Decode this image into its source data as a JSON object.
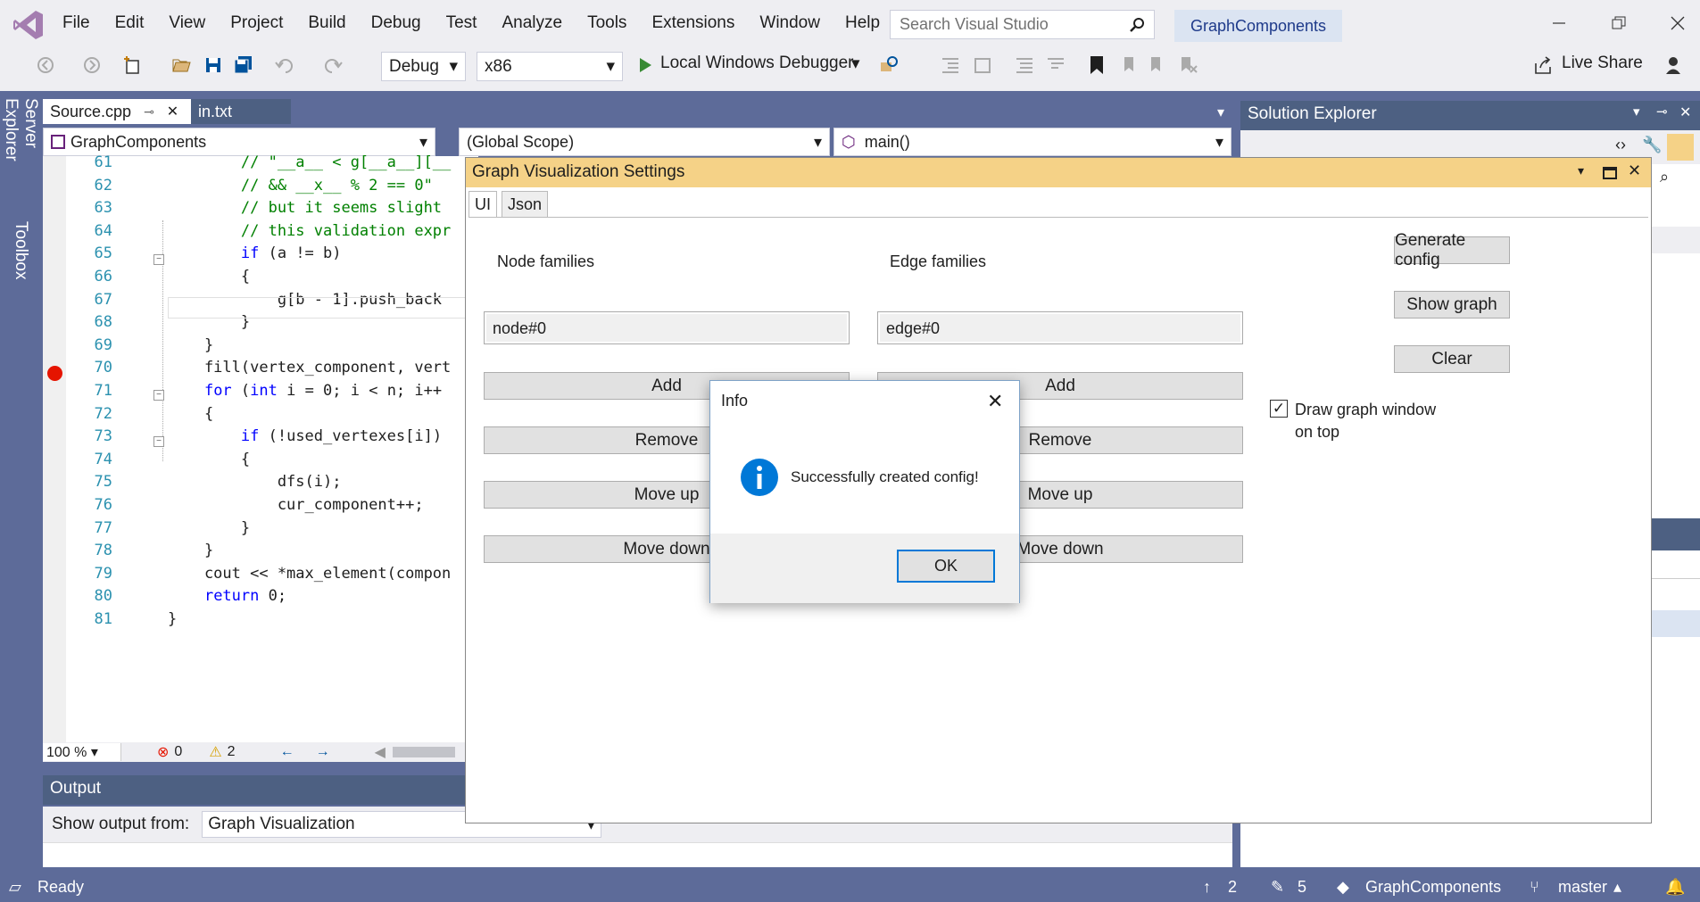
{
  "menu": [
    "File",
    "Edit",
    "View",
    "Project",
    "Build",
    "Debug",
    "Test",
    "Analyze",
    "Tools",
    "Extensions",
    "Window",
    "Help"
  ],
  "search": {
    "placeholder": "Search Visual Studio"
  },
  "solution_name": "GraphComponents",
  "toolbar": {
    "config": "Debug",
    "platform": "x86",
    "debugger": "Local Windows Debugger",
    "live_share": "Live Share"
  },
  "side_tabs": [
    "Server Explorer",
    "Toolbox"
  ],
  "doc_tabs": [
    {
      "label": "Source.cpp"
    },
    {
      "label": "in.txt"
    }
  ],
  "nav": {
    "project": "GraphComponents",
    "scope": "(Global Scope)",
    "member": "main()"
  },
  "code_lines": [
    {
      "n": "61",
      "text": "        // \"__a__ < g[__a__][__"
    },
    {
      "n": "62",
      "text": "        // && __x__ % 2 == 0\""
    },
    {
      "n": "63",
      "text": "        // but it seems slight"
    },
    {
      "n": "64",
      "text": "        // this validation expr"
    },
    {
      "n": "65",
      "text": "        if (a != b)"
    },
    {
      "n": "66",
      "text": "        {"
    },
    {
      "n": "67",
      "text": "            g[b - 1].push_back"
    },
    {
      "n": "68",
      "text": "        }"
    },
    {
      "n": "69",
      "text": "    }"
    },
    {
      "n": "70",
      "text": "    fill(vertex_component, vert"
    },
    {
      "n": "71",
      "text": "    for (int i = 0; i < n; i++"
    },
    {
      "n": "72",
      "text": "    {"
    },
    {
      "n": "73",
      "text": "        if (!used_vertexes[i])"
    },
    {
      "n": "74",
      "text": "        {"
    },
    {
      "n": "75",
      "text": "            dfs(i);"
    },
    {
      "n": "76",
      "text": "            cur_component++;"
    },
    {
      "n": "77",
      "text": "        }"
    },
    {
      "n": "78",
      "text": "    }"
    },
    {
      "n": "79",
      "text": "    cout << *max_element(compon"
    },
    {
      "n": "80",
      "text": "    return 0;"
    },
    {
      "n": "81",
      "text": "}"
    }
  ],
  "editor_status": {
    "zoom": "100 %",
    "errors": "0",
    "warnings": "2"
  },
  "output": {
    "title": "Output",
    "show_from_label": "Show output from:",
    "source": "Graph Visualization"
  },
  "solution_explorer": {
    "title": "Solution Explorer"
  },
  "status": {
    "ready": "Ready",
    "up": "2",
    "edits": "5",
    "repo": "GraphComponents",
    "branch": "master"
  },
  "settings": {
    "title": "Graph Visualization Settings",
    "tabs": [
      "UI",
      "Json"
    ],
    "node_families_label": "Node families",
    "edge_families_label": "Edge families",
    "node_value": "node#0",
    "edge_value": "edge#0",
    "add": "Add",
    "remove": "Remove",
    "move_up": "Move up",
    "move_down": "Move down",
    "generate": "Generate config",
    "show_graph": "Show graph",
    "clear": "Clear",
    "draw_on_top": "Draw graph window on top",
    "draw_on_top_checked": true
  },
  "info": {
    "title": "Info",
    "message": "Successfully created config!",
    "ok": "OK"
  },
  "colors": {
    "accent": "#0078d7",
    "chrome": "#eeeef2",
    "frame": "#5d6b99",
    "dialog_title": "#f5d287"
  }
}
